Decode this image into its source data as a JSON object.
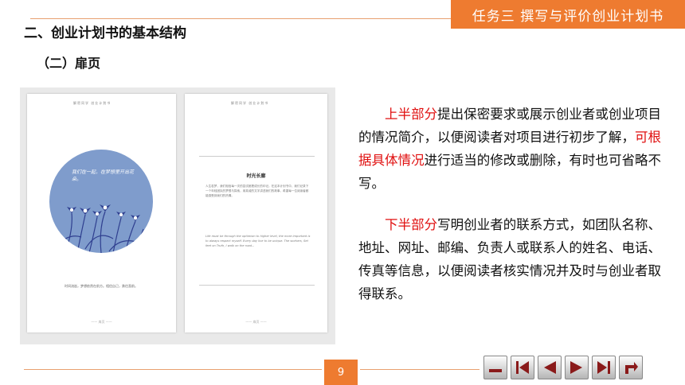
{
  "header": {
    "task_banner": "任务三  撰写与评价创业计划书",
    "section_title": "二、创业计划书的基本结构",
    "subsection_title": "（二）扉页"
  },
  "book_image": {
    "left_page_header": "解密同学  创业计划书",
    "circle_text": "我们在一起，在梦想里开出花朵。",
    "left_poem": "时间流逝，梦想依然在前方。相信自己，勇往直前。",
    "left_footer": "—— 扉页 ——",
    "right_page_header": "解密同学  创业计划书",
    "right_title": "时光长廊",
    "right_body": "人生若梦，我们相信每一次的尝试都是成长的印记。在这本计划书中，我们记录下一个年轻团队的梦想与探索，用真诚的文字讲述我们的故事，希望每一位阅读者都能感受到我们的热情。",
    "right_english": "Life must be through the optimism to higher level, the more important is to always respect myself. Every day live to be unique. The workers, Set feet on Truth, I walk on the road...",
    "right_footer": "—— 扉页 ——"
  },
  "content": {
    "para1_lead": "上半部分",
    "para1_a": "提出保密要求或展示创业者或创业项目的情况简介，以便阅读者对项目进行初步了解，",
    "para1_red": "可根据具体情况",
    "para1_b": "进行适当的修改或删除，有时也可省略不写。",
    "para2_lead": "下半部分",
    "para2_a": "写明创业者的联系方式，如团队名称、地址、网址、邮编、负责人或联系人的姓名、电话、传真等信息，以便阅读者核实情况并及时与创业者取得联系。"
  },
  "footer": {
    "page_number": "9"
  },
  "nav": {
    "buttons": [
      "blank-icon",
      "first-icon",
      "prev-icon",
      "next-icon",
      "last-icon",
      "return-icon"
    ]
  },
  "colors": {
    "accent": "#ee7b30",
    "highlight": "#e01010",
    "circle": "#7f9ccc",
    "iris": "#2f3f8f"
  }
}
